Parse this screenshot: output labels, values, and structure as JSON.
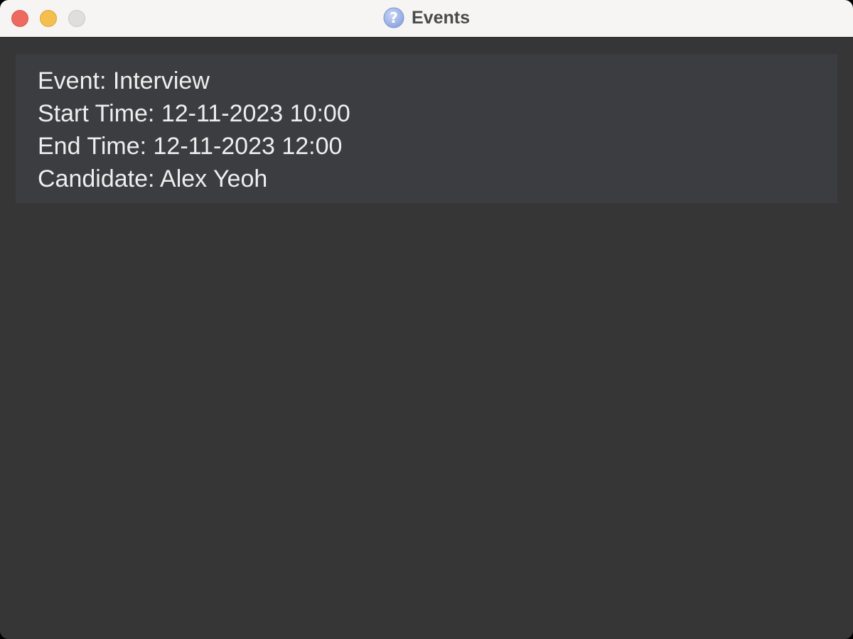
{
  "window": {
    "title": "Events",
    "title_icon": "help-question-icon",
    "controls": [
      "close",
      "minimize",
      "zoom"
    ]
  },
  "event": {
    "name_line": "Event: Interview",
    "start_line": "Start Time: 12-11-2023 10:00",
    "end_line": "End Time: 12-11-2023 12:00",
    "candidate_line": "Candidate: Alex Yeoh"
  },
  "colors": {
    "background": "#363636",
    "card": "#3c3d40",
    "text": "#eeeeee",
    "titlebar": "#f6f5f4",
    "close": "#ee6a5f",
    "minimize": "#f5bf4f",
    "zoom": "#dedede"
  }
}
